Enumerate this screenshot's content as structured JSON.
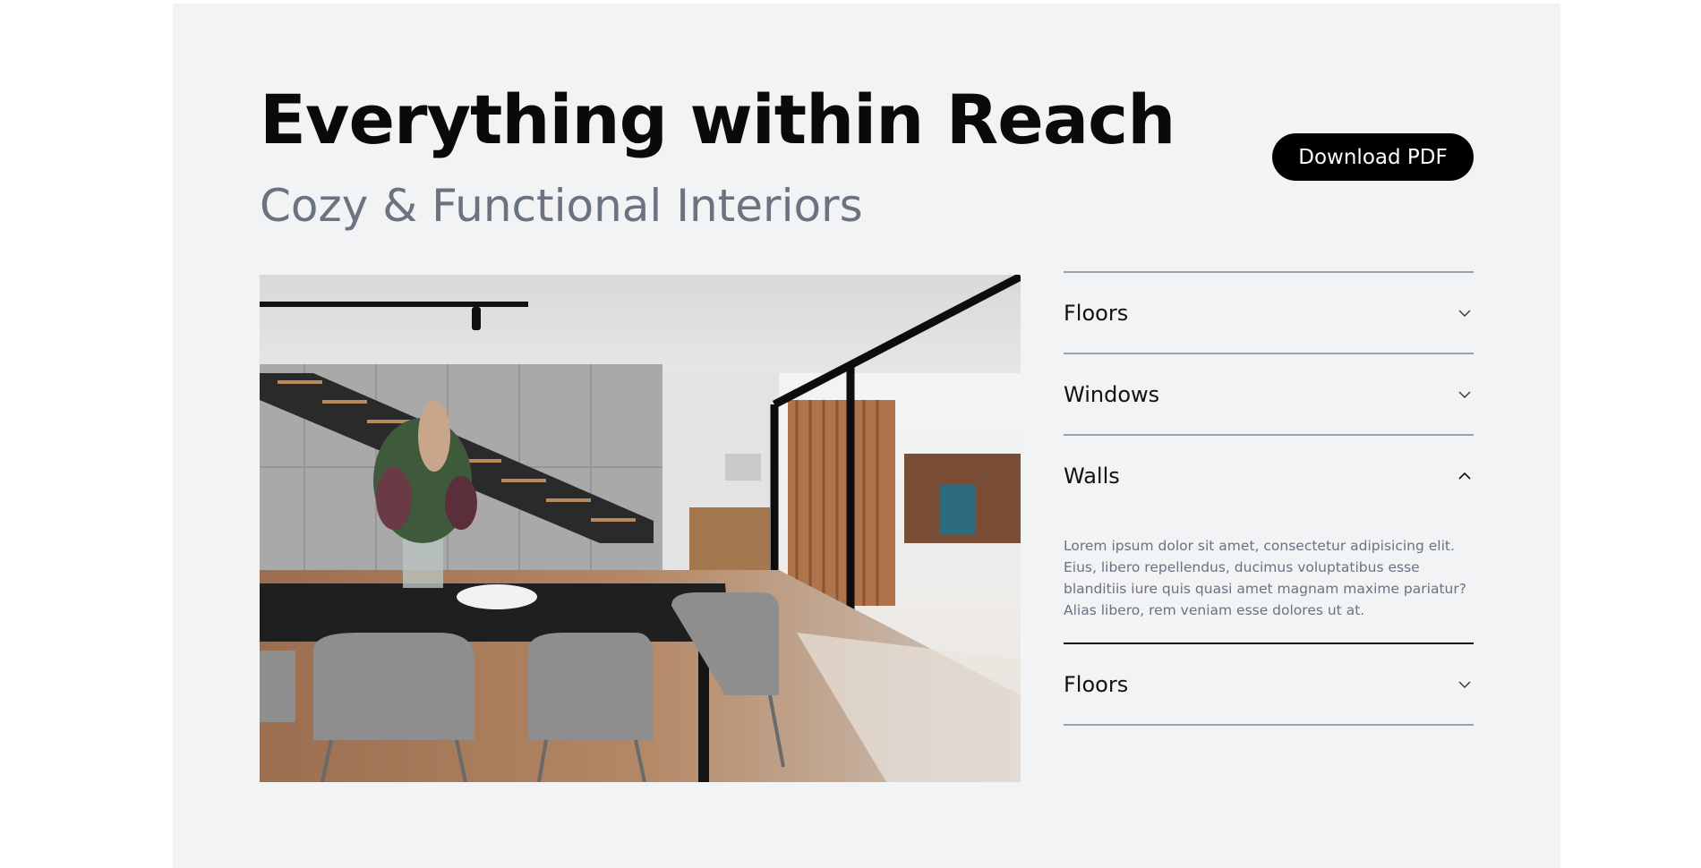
{
  "header": {
    "title": "Everything within Reach",
    "subtitle": "Cozy & Functional Interiors",
    "download_label": "Download PDF"
  },
  "image": {
    "description_icon": "interior-photo"
  },
  "accordion": {
    "items": [
      {
        "label": "Floors",
        "expanded": false,
        "icon": "chevron-down-icon"
      },
      {
        "label": "Windows",
        "expanded": false,
        "icon": "chevron-down-icon"
      },
      {
        "label": "Walls",
        "expanded": true,
        "icon": "chevron-up-icon",
        "body": "Lorem ipsum dolor sit amet, consectetur adipisicing elit. Eius, libero repellendus, ducimus voluptatibus esse blanditiis iure quis quasi amet magnam maxime pariatur? Alias libero, rem veniam esse dolores ut at."
      },
      {
        "label": "Floors",
        "expanded": false,
        "icon": "chevron-down-icon"
      }
    ]
  },
  "colors": {
    "page_background": "#f2f3f5",
    "button_background": "#000000",
    "subtitle": "#6b7280"
  }
}
